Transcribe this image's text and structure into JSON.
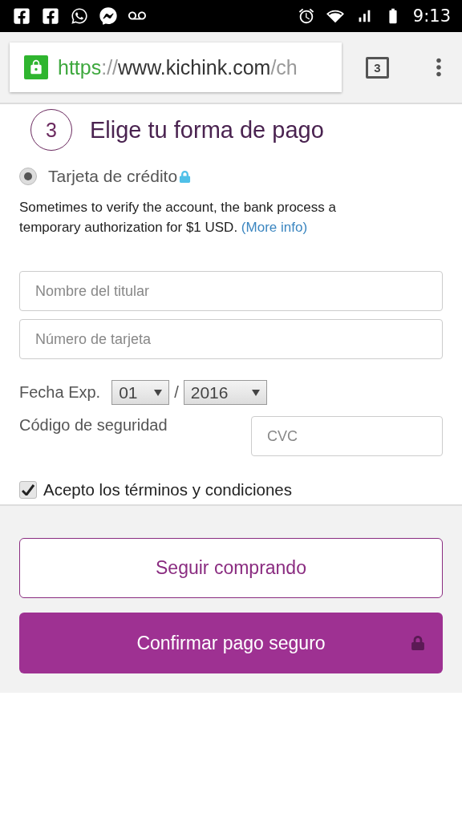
{
  "status_bar": {
    "time": "9:13"
  },
  "browser": {
    "url_parts": [
      {
        "text": "https",
        "kind": "scheme"
      },
      {
        "text": "://",
        "kind": "muted"
      },
      {
        "text": "www.kichink.com",
        "kind": "host"
      },
      {
        "text": "/ch",
        "kind": "muted"
      }
    ],
    "tab_count": "3"
  },
  "step": {
    "number": "3",
    "title": "Elige tu forma de pago"
  },
  "payment_option": {
    "label": "Tarjeta de crédito",
    "selected": true
  },
  "notice": {
    "text": "Sometimes to verify the account, the bank process a temporary authorization for $1 USD.",
    "link": "(More info)"
  },
  "fields": [
    {
      "placeholder": "Nombre del titular"
    },
    {
      "placeholder": "Número de tarjeta"
    }
  ],
  "expiry": {
    "label": "Fecha Exp.",
    "month": "01",
    "separator": "/",
    "year": "2016"
  },
  "security": {
    "label": "Código de seguridad",
    "placeholder": "CVC"
  },
  "terms": {
    "label": "Acepto los términos y condiciones",
    "checked": true
  },
  "buttons": [
    {
      "label": "Seguir comprando",
      "kind": "outline"
    },
    {
      "label": "Confirmar pago seguro",
      "kind": "primary"
    }
  ]
}
